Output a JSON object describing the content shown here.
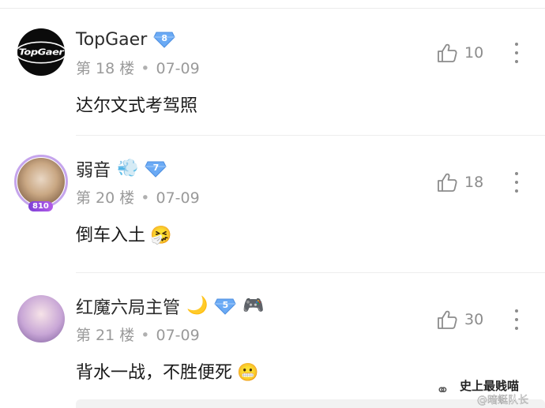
{
  "comments": [
    {
      "username": "TopGaer",
      "avatar_text": "TopGaer",
      "level": "8",
      "floor": "第 18 楼",
      "date": "07-09",
      "content": "达尔文式考驾照",
      "content_emoji": "",
      "likes": "10",
      "name_icons": []
    },
    {
      "username": "弱音",
      "level": "7",
      "floor": "第 20 楼",
      "date": "07-09",
      "content": "倒车入土",
      "content_emoji": "🤧",
      "likes": "18",
      "avatar_badge": "810",
      "name_icons": [
        "💨"
      ]
    },
    {
      "username": "红魔六局主管",
      "level": "5",
      "floor": "第 21 楼",
      "date": "07-09",
      "content": "背水一战，不胜便死",
      "content_emoji": "😬",
      "likes": "30",
      "name_icons": [
        "🌙",
        "🎮"
      ]
    }
  ],
  "separator": "•",
  "watermark": {
    "main": "史上最贱喵",
    "sub": "@暗蜓队长",
    "icon": "wechat-icon"
  },
  "colors": {
    "badge_blue": "#5aa0f2",
    "meta_gray": "#9a9a9a",
    "icon_gray": "#8c8c8c"
  }
}
